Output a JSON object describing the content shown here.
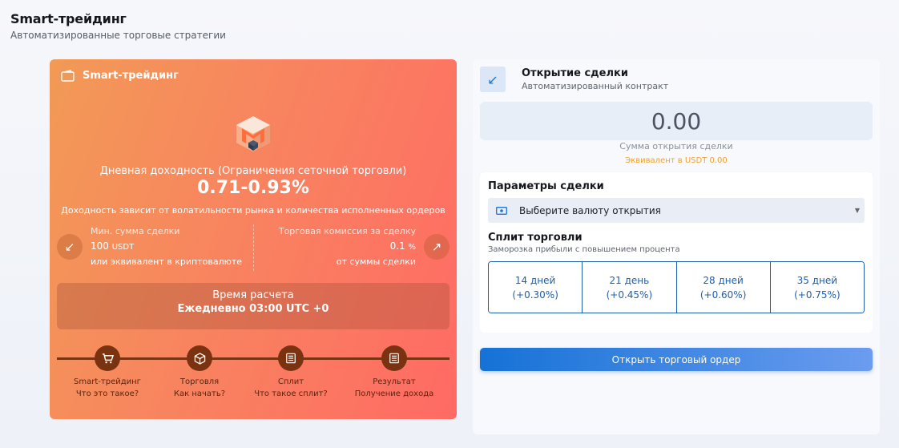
{
  "page": {
    "title": "Smart-трейдинг",
    "subtitle": "Автоматизированные торговые стратегии"
  },
  "promo": {
    "title": "Smart-трейдинг",
    "yield_caption": "Дневная доходность (Ограничения сеточной торговли)",
    "yield_value": "0.71-0.93%",
    "yield_note": "Доходность зависит от волатильности рынка и количества исполненных ордеров",
    "min_amount": {
      "label": "Мин. сумма сделки",
      "value": "100",
      "unit": "USDT",
      "sub": "или эквивалент в криптовалюте"
    },
    "commission": {
      "label": "Торговая комиссия за сделку",
      "value": "0.1",
      "unit": "%",
      "sub": "от суммы сделки"
    },
    "calc": {
      "label": "Время расчета",
      "time": "Ежедневно 03:00 UTC +0"
    },
    "steps": [
      {
        "title": "Smart-трейдинг",
        "sub": "Что это такое?",
        "icon": "cart-icon"
      },
      {
        "title": "Торговля",
        "sub": "Как начать?",
        "icon": "box-icon"
      },
      {
        "title": "Сплит",
        "sub": "Что такое сплит?",
        "icon": "document-icon"
      },
      {
        "title": "Результат",
        "sub": "Получение дохода",
        "icon": "document-icon"
      }
    ]
  },
  "trade": {
    "title": "Открытие сделки",
    "subtitle": "Автоматизированный контракт",
    "amount_value": "0.00",
    "amount_label": "Сумма открытия сделки",
    "amount_equiv": "Эквивалент в USDT 0.00",
    "params_title": "Параметры сделки",
    "currency_placeholder": "Выберите валюту открытия",
    "split_title": "Сплит торговли",
    "split_sub": "Заморозка прибыли с повышением процента",
    "split_options": [
      {
        "days": "14 дней",
        "rate": "(+0.30%)"
      },
      {
        "days": "21 день",
        "rate": "(+0.45%)"
      },
      {
        "days": "28 дней",
        "rate": "(+0.60%)"
      },
      {
        "days": "35 дней",
        "rate": "(+0.75%)"
      }
    ],
    "open_button": "Открыть торговый ордер"
  },
  "colors": {
    "promo_start": "#f29a56",
    "promo_end": "#ff6a64",
    "accent_blue": "#1d5fae",
    "button_blue": "#1572d6",
    "equiv_orange": "#f0a030",
    "timeline_brown": "#7a3210"
  }
}
